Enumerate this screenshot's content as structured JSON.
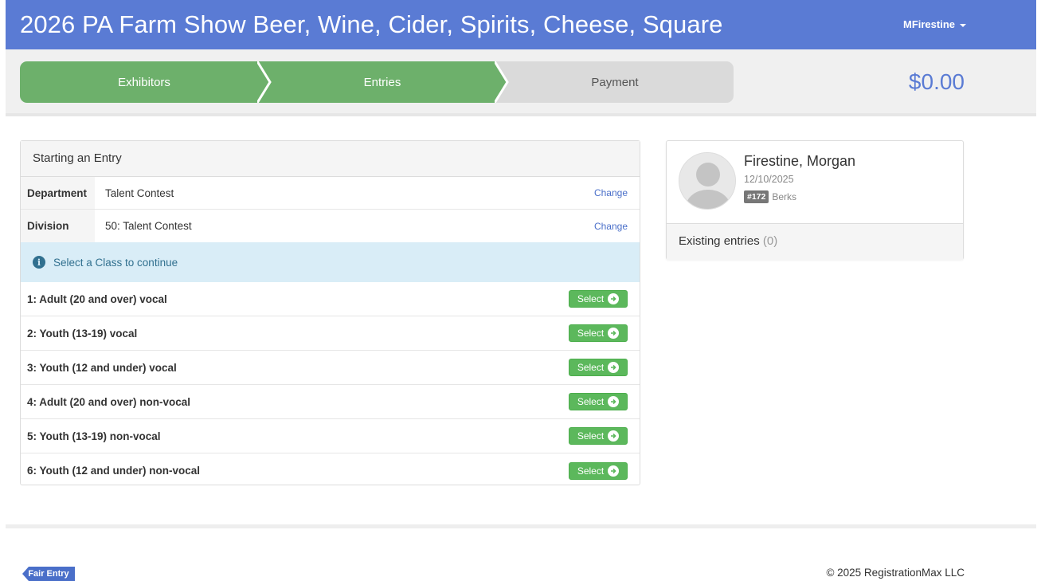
{
  "header": {
    "title": "2026 PA Farm Show Beer, Wine, Cider, Spirits, Cheese, Square",
    "user": "MFirestine",
    "brand_color": "#5a7bd4"
  },
  "progress": {
    "steps": [
      {
        "label": "Exhibitors",
        "state": "done"
      },
      {
        "label": "Entries",
        "state": "current"
      },
      {
        "label": "Payment",
        "state": "todo"
      }
    ],
    "total": "$0.00"
  },
  "entry": {
    "heading": "Starting an Entry",
    "department": {
      "label": "Department",
      "value": "Talent Contest",
      "action": "Change"
    },
    "division": {
      "label": "Division",
      "value": "50: Talent Contest",
      "action": "Change"
    },
    "alert": "Select a Class to continue",
    "select_label": "Select",
    "classes": [
      "1: Adult (20 and over) vocal",
      "2: Youth (13-19) vocal",
      "3: Youth (12 and under) vocal",
      "4: Adult (20 and over) non-vocal",
      "5: Youth (13-19) non-vocal",
      "6: Youth (12 and under) non-vocal"
    ]
  },
  "exhibitor": {
    "name": "Firestine, Morgan",
    "date": "12/10/2025",
    "number": "#172",
    "county": "Berks",
    "existing_label": "Existing entries",
    "existing_count": "(0)"
  },
  "footer": {
    "logo_text": "Fair Entry",
    "copyright": "© 2025 RegistrationMax LLC"
  }
}
